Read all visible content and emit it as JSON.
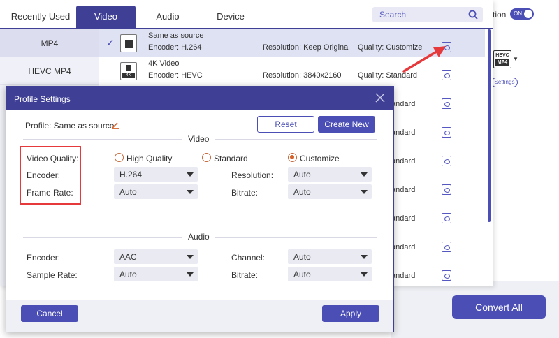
{
  "tabs": [
    {
      "label": "Recently Used"
    },
    {
      "label": "Video"
    },
    {
      "label": "Audio"
    },
    {
      "label": "Device"
    }
  ],
  "search": {
    "placeholder": "Search"
  },
  "toggle": {
    "label_partial": "tion",
    "state": "ON"
  },
  "right_pane": {
    "badge_top": "HEVC",
    "badge_bottom": "MP4",
    "settings_label": "Settings",
    "convert_label": "Convert All"
  },
  "side_list": [
    {
      "label": "MP4"
    },
    {
      "label": "HEVC MP4"
    }
  ],
  "profiles": [
    {
      "name": "Same as source",
      "encoder": "Encoder: H.264",
      "resolution": "Resolution: Keep Original",
      "quality": "Quality: Customize",
      "icon_label": ""
    },
    {
      "name": "4K Video",
      "encoder": "Encoder: HEVC",
      "resolution": "Resolution: 3840x2160",
      "quality": "Quality: Standard",
      "icon_label": "4K"
    },
    {
      "quality": "tandard"
    },
    {
      "quality": "tandard"
    },
    {
      "quality": "tandard"
    },
    {
      "quality": "tandard"
    },
    {
      "quality": "tandard"
    },
    {
      "quality": "tandard"
    },
    {
      "quality": "tandard"
    }
  ],
  "dialog": {
    "title": "Profile Settings",
    "profile_label": "Profile: Same as source",
    "reset_label": "Reset",
    "create_label": "Create New",
    "video_section": "Video",
    "audio_section": "Audio",
    "video": {
      "quality_label": "Video Quality:",
      "quality_options": [
        "High Quality",
        "Standard",
        "Customize"
      ],
      "quality_selected": "Customize",
      "encoder_label": "Encoder:",
      "encoder_value": "H.264",
      "resolution_label": "Resolution:",
      "resolution_value": "Auto",
      "framerate_label": "Frame Rate:",
      "framerate_value": "Auto",
      "bitrate_label": "Bitrate:",
      "bitrate_value": "Auto"
    },
    "audio": {
      "encoder_label": "Encoder:",
      "encoder_value": "AAC",
      "channel_label": "Channel:",
      "channel_value": "Auto",
      "samplerate_label": "Sample Rate:",
      "samplerate_value": "Auto",
      "bitrate_label": "Bitrate:",
      "bitrate_value": "Auto"
    },
    "cancel_label": "Cancel",
    "apply_label": "Apply"
  },
  "colors": {
    "accent": "#4b4fb5",
    "header": "#3f3f96",
    "highlight": "#e5393c",
    "radio": "#d4622a"
  }
}
